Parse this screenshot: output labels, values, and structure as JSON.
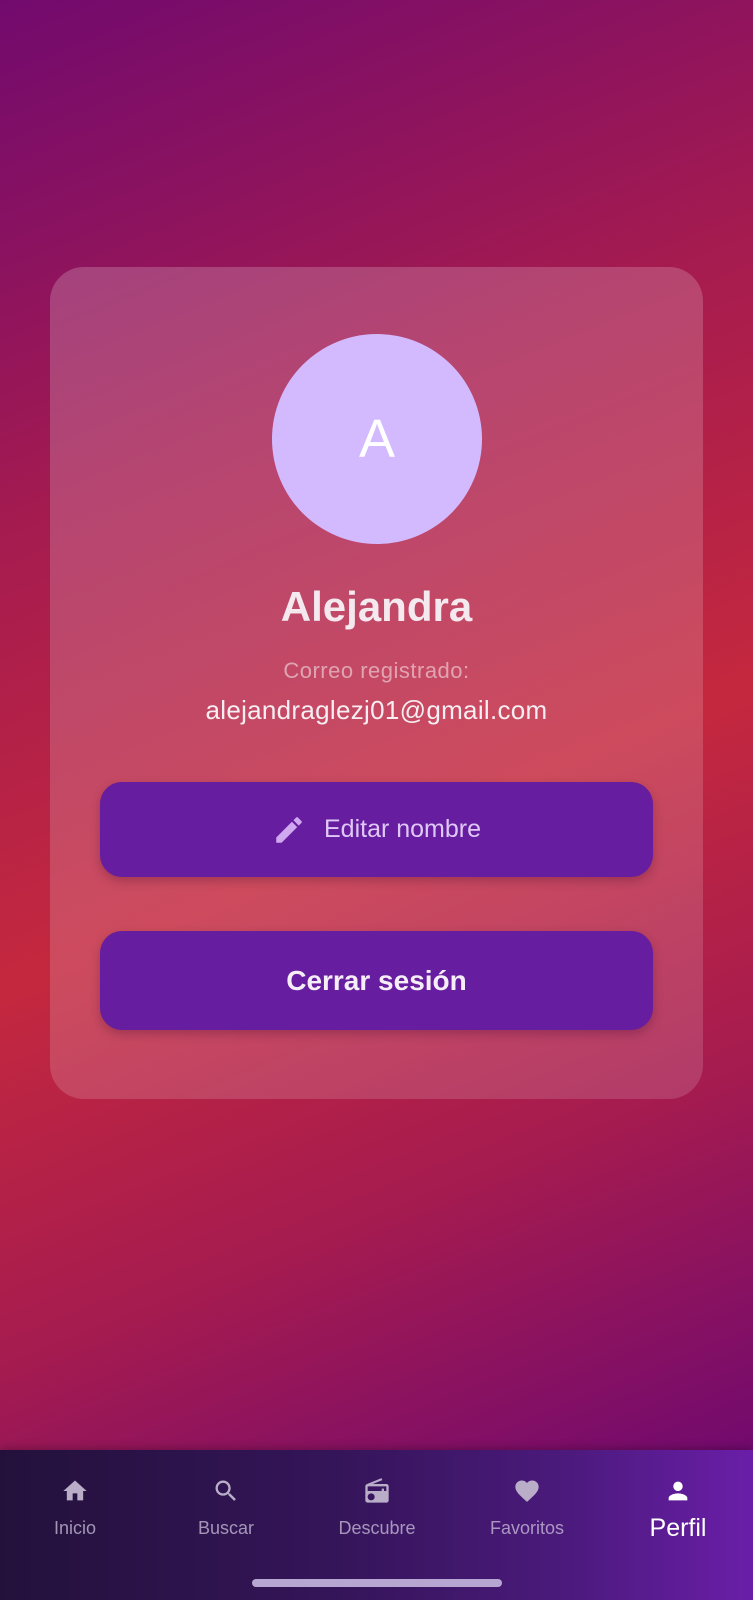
{
  "profile": {
    "avatar_initial": "A",
    "name": "Alejandra",
    "email_label": "Correo registrado:",
    "email": "alejandraglezj01@gmail.com"
  },
  "actions": {
    "edit_label": "Editar nombre",
    "logout_label": "Cerrar sesión"
  },
  "nav": {
    "items": [
      {
        "label": "Inicio",
        "icon": "home-icon",
        "active": false
      },
      {
        "label": "Buscar",
        "icon": "search-icon",
        "active": false
      },
      {
        "label": "Descubre",
        "icon": "radio-icon",
        "active": false
      },
      {
        "label": "Favoritos",
        "icon": "heart-icon",
        "active": false
      },
      {
        "label": "Perfil",
        "icon": "person-icon",
        "active": true
      }
    ]
  },
  "colors": {
    "avatar_bg": "#d3baff",
    "button_bg": "#661d9f",
    "gradient_primary": "#c4283e",
    "gradient_secondary": "#720a6e"
  }
}
